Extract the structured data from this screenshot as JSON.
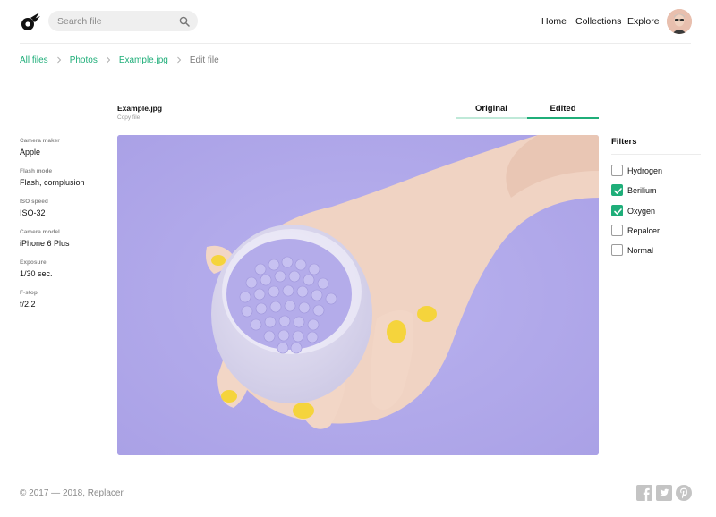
{
  "header": {
    "logo_icon": "comet-logo-icon",
    "search": {
      "placeholder": "Search file",
      "icon": "search-icon"
    },
    "nav": [
      "Home",
      "Collections",
      "Explore"
    ],
    "avatar_icon": "user-avatar"
  },
  "breadcrumb": {
    "items": [
      "All files",
      "Photos",
      "Example.jpg",
      "Edit file"
    ],
    "separator_icon": "chevron-right-icon"
  },
  "file": {
    "name": "Example.jpg",
    "copy_label": "Copy file"
  },
  "tabs": {
    "original": "Original",
    "edited": "Edited",
    "active": "Edited"
  },
  "metadata": [
    {
      "label": "Camera maker",
      "value": "Apple"
    },
    {
      "label": "Flash mode",
      "value": "Flash, complusion"
    },
    {
      "label": "ISO speed",
      "value": "ISO-32"
    },
    {
      "label": "Camera model",
      "value": "iPhone 6 Plus"
    },
    {
      "label": "Exposure",
      "value": "1/30 sec."
    },
    {
      "label": "F-stop",
      "value": "f/2.2"
    }
  ],
  "filters": {
    "title": "Filters",
    "items": [
      {
        "label": "Hydrogen",
        "checked": false
      },
      {
        "label": "Berilium",
        "checked": true
      },
      {
        "label": "Oxygen",
        "checked": true
      },
      {
        "label": "Repalcer",
        "checked": false
      },
      {
        "label": "Normal",
        "checked": false
      }
    ]
  },
  "footer": {
    "copyright": "© 2017 — 2018, Replacer",
    "social": [
      "facebook-icon",
      "twitter-icon",
      "pinterest-icon"
    ]
  },
  "colors": {
    "accent": "#1fae79",
    "accent_light": "#bfe9d8",
    "photo_background": "#b2aaeb",
    "nail_yellow": "#f5d43c"
  }
}
